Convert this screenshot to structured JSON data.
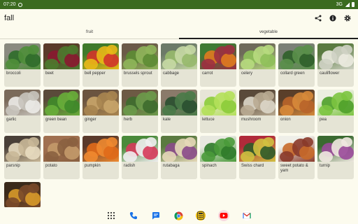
{
  "status": {
    "time": "07:20",
    "network": "3G"
  },
  "appbar": {
    "title": "fall"
  },
  "tabs": [
    {
      "label": "fruit",
      "active": false
    },
    {
      "label": "vegetable",
      "active": true
    }
  ],
  "items": [
    {
      "label": "broccoli",
      "colors": [
        "#2f6b2a",
        "#4f8e3a",
        "#8a8a80"
      ]
    },
    {
      "label": "beet",
      "colors": [
        "#8a1830",
        "#4c7a2e",
        "#5a3a2a"
      ]
    },
    {
      "label": "bell pepper",
      "colors": [
        "#d1342a",
        "#e8b817",
        "#3f7a2a"
      ]
    },
    {
      "label": "brussels sprout",
      "colors": [
        "#5d8c34",
        "#8fb55a",
        "#6b5a48"
      ]
    },
    {
      "label": "cabbage",
      "colors": [
        "#97b96c",
        "#c6d9a4",
        "#6c7a68"
      ]
    },
    {
      "label": "carrot",
      "colors": [
        "#e07b1f",
        "#9c3040",
        "#3f7a34"
      ]
    },
    {
      "label": "celery",
      "colors": [
        "#8fc05a",
        "#b7da7e",
        "#6e6a5a"
      ]
    },
    {
      "label": "collard green",
      "colors": [
        "#2f5f2a",
        "#5a8f4a",
        "#7b8076"
      ]
    },
    {
      "label": "cauliflower",
      "colors": [
        "#ecebe0",
        "#cfd2c4",
        "#5a7a40"
      ]
    },
    {
      "label": "garlic",
      "colors": [
        "#ecebe8",
        "#c8c4bc",
        "#7a6a5a"
      ]
    },
    {
      "label": "green bean",
      "colors": [
        "#3f8a2a",
        "#68ae3a",
        "#5a4a3a"
      ]
    },
    {
      "label": "ginger",
      "colors": [
        "#c9a56a",
        "#a98550",
        "#6b5440"
      ]
    },
    {
      "label": "herb",
      "colors": [
        "#3e6b2e",
        "#6b9a4a",
        "#6d5a44"
      ]
    },
    {
      "label": "kale",
      "colors": [
        "#2a4f30",
        "#4a7a48",
        "#8a7a6a"
      ]
    },
    {
      "label": "lettuce",
      "colors": [
        "#8ccc3a",
        "#b4e05a",
        "#e7e5d8"
      ]
    },
    {
      "label": "mushroom",
      "colors": [
        "#dcd6c8",
        "#b9ab92",
        "#5a4a3a"
      ]
    },
    {
      "label": "onion",
      "colors": [
        "#b8642a",
        "#d78a3a",
        "#5a3f2a"
      ]
    },
    {
      "label": "pea",
      "colors": [
        "#4fa02a",
        "#7cc440",
        "#ecefe0"
      ]
    },
    {
      "label": "parsnip",
      "colors": [
        "#e8dcc0",
        "#c9b898",
        "#4a4038"
      ]
    },
    {
      "label": "potato",
      "colors": [
        "#c39a6a",
        "#8a6040",
        "#a07050"
      ]
    },
    {
      "label": "pumpkin",
      "colors": [
        "#e06a1a",
        "#f08a30",
        "#5a3a2a"
      ]
    },
    {
      "label": "radish",
      "colors": [
        "#d63a5a",
        "#f0eef0",
        "#4a8a3a"
      ]
    },
    {
      "label": "rutabaga",
      "colors": [
        "#8a4a8a",
        "#e6d8b8",
        "#5a7a40"
      ]
    },
    {
      "label": "spinach",
      "colors": [
        "#2f7a2a",
        "#4a9a3a",
        "#e8e8e0"
      ]
    },
    {
      "label": "Swiss chard",
      "colors": [
        "#2e5a2a",
        "#d0c040",
        "#b02a3a"
      ]
    },
    {
      "label": "sweet potato & yam",
      "colors": [
        "#c86a2a",
        "#8a3a2a",
        "#efefe8"
      ]
    },
    {
      "label": "turnip",
      "colors": [
        "#9a4a9a",
        "#efe8e0",
        "#3a6a30"
      ]
    },
    {
      "label": "",
      "colors": [
        "#d89a2a",
        "#7a4a2a",
        "#3a2a1a"
      ]
    }
  ],
  "nav": [
    {
      "name": "apps-icon",
      "bg": "transparent",
      "fg": "#333333"
    },
    {
      "name": "phone-icon",
      "bg": "transparent",
      "fg": "#1a73e8"
    },
    {
      "name": "messages-icon",
      "bg": "transparent",
      "fg": "#1a73e8"
    },
    {
      "name": "chrome-icon",
      "bg": "#ffffff",
      "fg": "#db4437"
    },
    {
      "name": "calculator-icon",
      "bg": "#f4c20d",
      "fg": "#333333"
    },
    {
      "name": "youtube-icon",
      "bg": "#f7d9e0",
      "fg": "#ff0000"
    },
    {
      "name": "gmail-icon",
      "bg": "#ffffff",
      "fg": "#d93025"
    }
  ]
}
